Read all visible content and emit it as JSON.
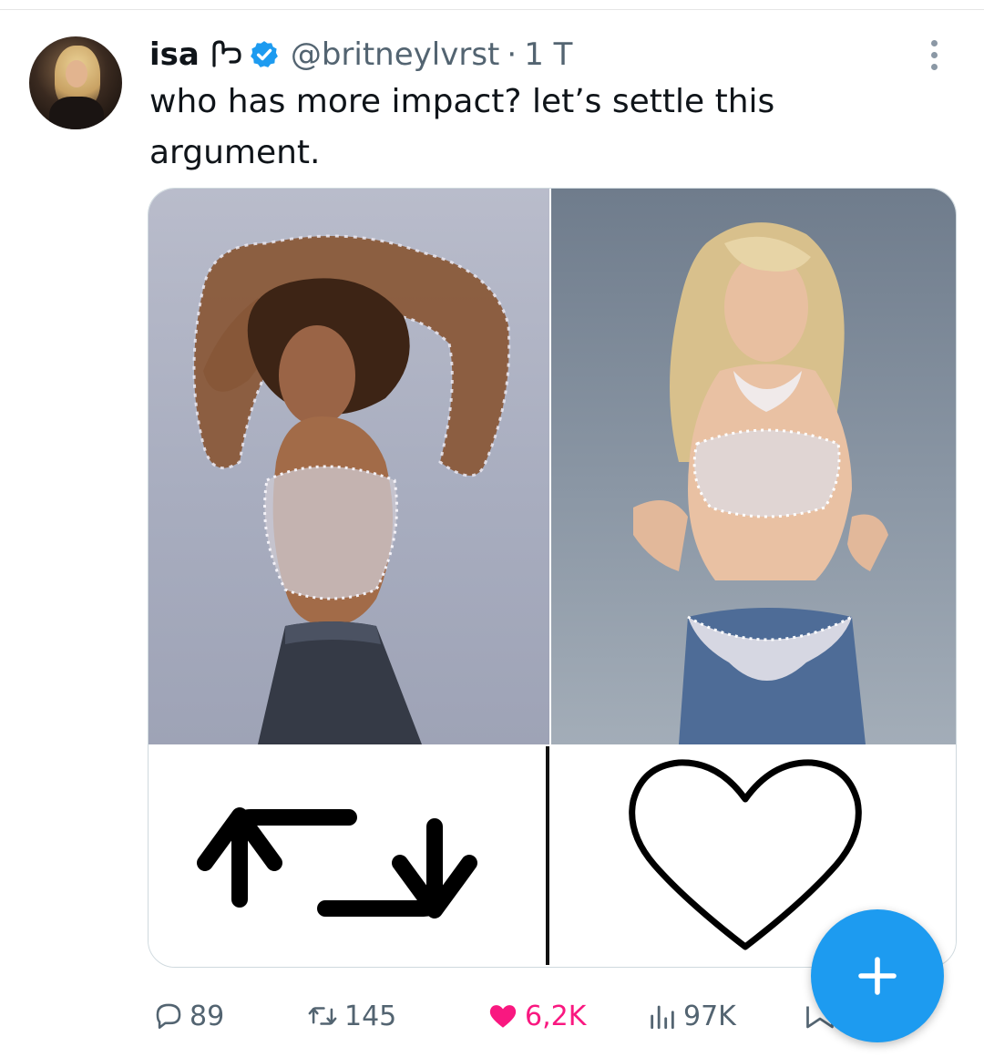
{
  "tweet": {
    "display_name": "isa",
    "handle": "@britneylvrst",
    "separator": "·",
    "time": "1 T",
    "text": "who has more impact? let’s settle this argument."
  },
  "actions": {
    "reply_count": "89",
    "retweet_count": "145",
    "like_count": "6,2K",
    "view_count": "97K"
  },
  "icons": {
    "verified": "verified-badge-icon",
    "more": "more-options-icon",
    "reply": "reply-icon",
    "retweet": "retweet-icon",
    "like": "heart-filled-icon",
    "views": "views-icon",
    "share": "share-icon",
    "compose": "compose-plus-icon"
  },
  "colors": {
    "accent": "#1d9bf0",
    "like": "#f91880",
    "secondary_text": "#536471",
    "primary_text": "#0f1419"
  }
}
